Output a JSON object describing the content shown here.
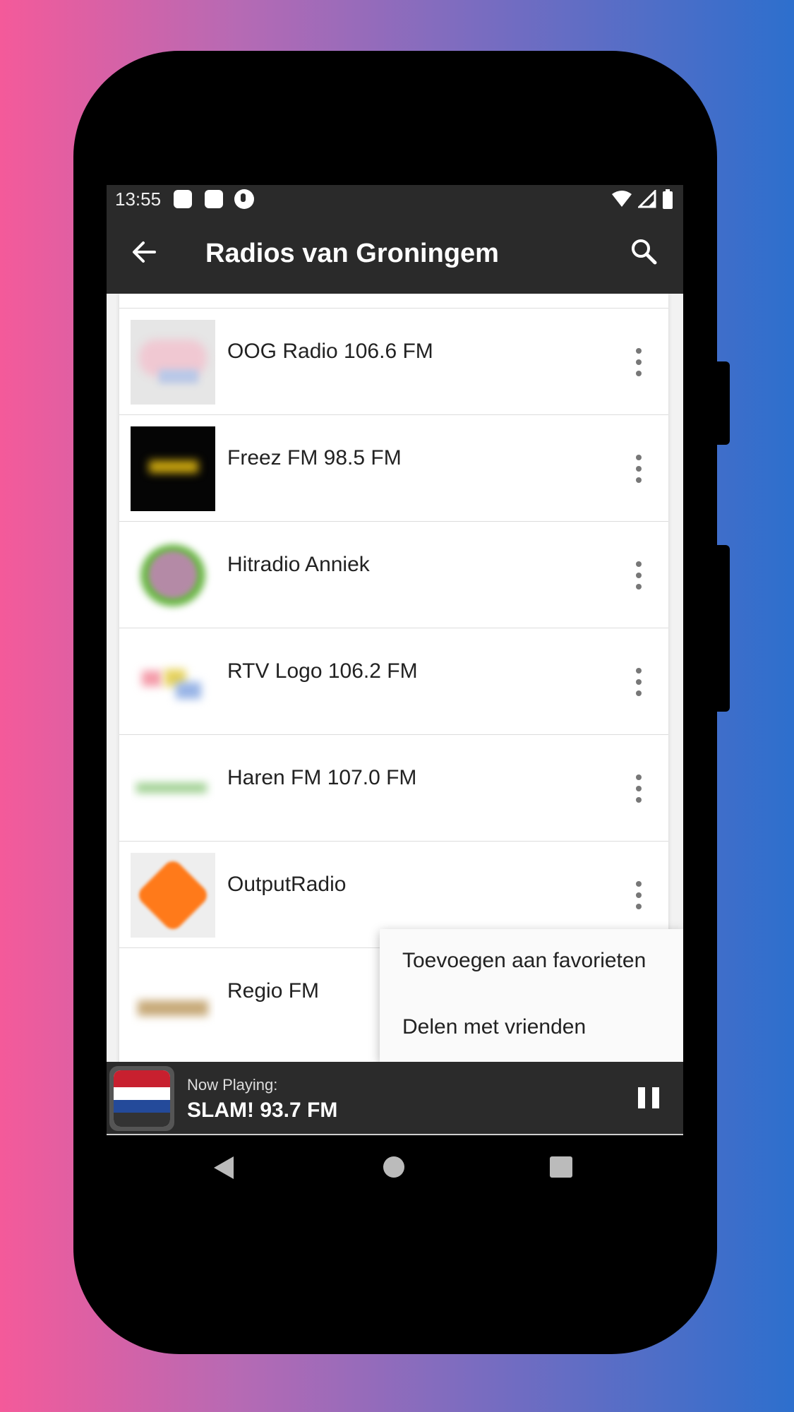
{
  "status_bar": {
    "time": "13:55"
  },
  "toolbar": {
    "title": "Radios van Groningem"
  },
  "stations": [
    {
      "name": "OOG Radio 106.6 FM"
    },
    {
      "name": "Freez FM 98.5 FM"
    },
    {
      "name": "Hitradio Anniek"
    },
    {
      "name": "RTV Logo 106.2 FM"
    },
    {
      "name": "Haren FM 107.0 FM"
    },
    {
      "name": "OutputRadio"
    },
    {
      "name": "Regio FM"
    }
  ],
  "context_menu": {
    "items": [
      {
        "label": "Toevoegen aan favorieten"
      },
      {
        "label": "Delen met vrienden"
      }
    ]
  },
  "player": {
    "label": "Now Playing:",
    "title": "SLAM! 93.7 FM"
  },
  "colors": {
    "bar_bg": "#2a2a2a",
    "accent_orange": "#ff7a1a"
  }
}
